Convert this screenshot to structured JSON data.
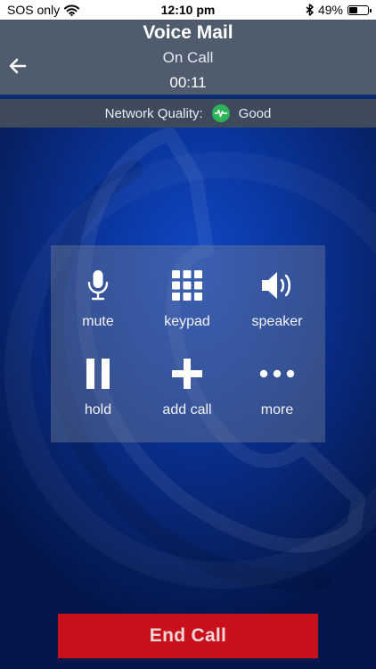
{
  "status_bar": {
    "carrier": "SOS only",
    "time": "12:10 pm",
    "battery_percent_text": "49%",
    "battery_level": 0.49
  },
  "header": {
    "title": "Voice Mail",
    "subtitle": "On Call",
    "timer": "00:11"
  },
  "network": {
    "label": "Network Quality:",
    "value": "Good",
    "status_color": "#2fb35a"
  },
  "controls": {
    "mute": "mute",
    "keypad": "keypad",
    "speaker": "speaker",
    "hold": "hold",
    "add_call": "add call",
    "more": "more"
  },
  "end_call": {
    "label": "End Call",
    "color": "#c8111d"
  }
}
